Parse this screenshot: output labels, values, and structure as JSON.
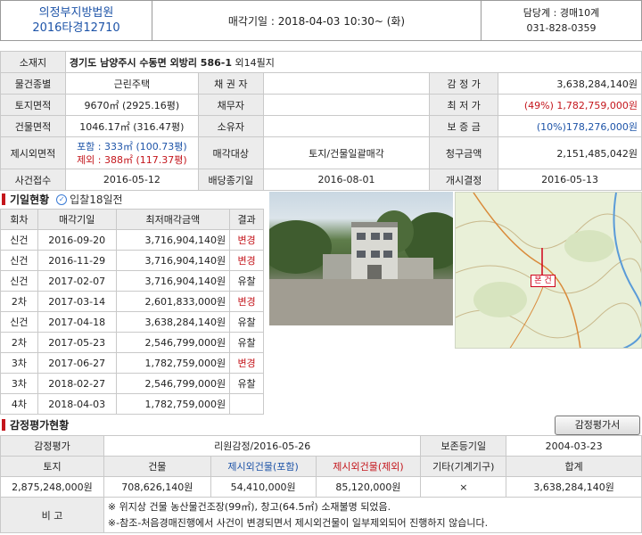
{
  "header": {
    "court": "의정부지방법원",
    "case_no": "2016타경12710",
    "auction_date": "매각기일 : 2018-04-03   10:30~ (화)",
    "dept": "담당계 : 경매10계",
    "phone": "031-828-0359"
  },
  "info": {
    "address_label": "소재지",
    "address": "경기도 남양주시 수동면 외방리 586-1",
    "address_extra": "외14필지",
    "rows": [
      {
        "l1": "물건종별",
        "v1": "근린주택",
        "l2": "채 권 자",
        "v2": "",
        "l3": "감 정 가",
        "v3": "3,638,284,140원"
      },
      {
        "l1": "토지면적",
        "v1": "9670㎡ (2925.16평)",
        "l2": "채무자",
        "v2": "",
        "l3": "최 저 가",
        "v3": "(49%) 1,782,759,000원"
      },
      {
        "l1": "건물면적",
        "v1": "1046.17㎡ (316.47평)",
        "l2": "소유자",
        "v2": "",
        "l3": "보 증 금",
        "v3": "(10%)178,276,000원"
      }
    ],
    "excl_label": "제시외면적",
    "excl_incl": "포함 : 333㎡ (100.73평)",
    "excl_excl": "제외 : 388㎡ (117.37평)",
    "sale_target_label": "매각대상",
    "sale_target": "토지/건물일괄매각",
    "claim_label": "청구금액",
    "claim": "2,151,485,042원",
    "receipt_label": "사건접수",
    "receipt": "2016-05-12",
    "dividend_label": "배당종기일",
    "dividend": "2016-08-01",
    "start_label": "개시결정",
    "start": "2016-05-13"
  },
  "history": {
    "title": "기일현황",
    "sub": "입찰18일전",
    "headers": [
      "회차",
      "매각기일",
      "최저매각금액",
      "결과"
    ],
    "rows": [
      {
        "round": "신건",
        "date": "2016-09-20",
        "amount": "3,716,904,140원",
        "result": "변경"
      },
      {
        "round": "신건",
        "date": "2016-11-29",
        "amount": "3,716,904,140원",
        "result": "변경"
      },
      {
        "round": "신건",
        "date": "2017-02-07",
        "amount": "3,716,904,140원",
        "result": "유찰"
      },
      {
        "round": "2차",
        "date": "2017-03-14",
        "amount": "2,601,833,000원",
        "result": "변경"
      },
      {
        "round": "신건",
        "date": "2017-04-18",
        "amount": "3,638,284,140원",
        "result": "유찰"
      },
      {
        "round": "2차",
        "date": "2017-05-23",
        "amount": "2,546,799,000원",
        "result": "유찰"
      },
      {
        "round": "3차",
        "date": "2017-06-27",
        "amount": "1,782,759,000원",
        "result": "변경"
      },
      {
        "round": "3차",
        "date": "2018-02-27",
        "amount": "2,546,799,000원",
        "result": "유찰"
      },
      {
        "round": "4차",
        "date": "2018-04-03",
        "amount": "1,782,759,000원",
        "result": ""
      }
    ]
  },
  "map": {
    "marker_label": "본 건"
  },
  "appraisal": {
    "title": "감정평가현황",
    "button": "감정평가서",
    "row1_label": "감정평가",
    "agency": "리원감정/2016-05-26",
    "preserve_label": "보존등기일",
    "preserve": "2004-03-23",
    "headers": [
      "토지",
      "건물",
      "제시외건물(포함)",
      "제시외건물(제외)",
      "기타(기계기구)",
      "합계"
    ],
    "values": [
      "2,875,248,000원",
      "708,626,140원",
      "54,410,000원",
      "85,120,000원",
      "×",
      "3,638,284,140원"
    ],
    "note_label": "비 고",
    "note1": "※ 위지상 건물 농산물건조장(99㎡), 창고(64.5㎡) 소재불명 되었음.",
    "note2": "※-참조-처음경매진행에서 사건이 변경되면서 제시외건물이 일부제외되어 진행하지 않습니다."
  }
}
